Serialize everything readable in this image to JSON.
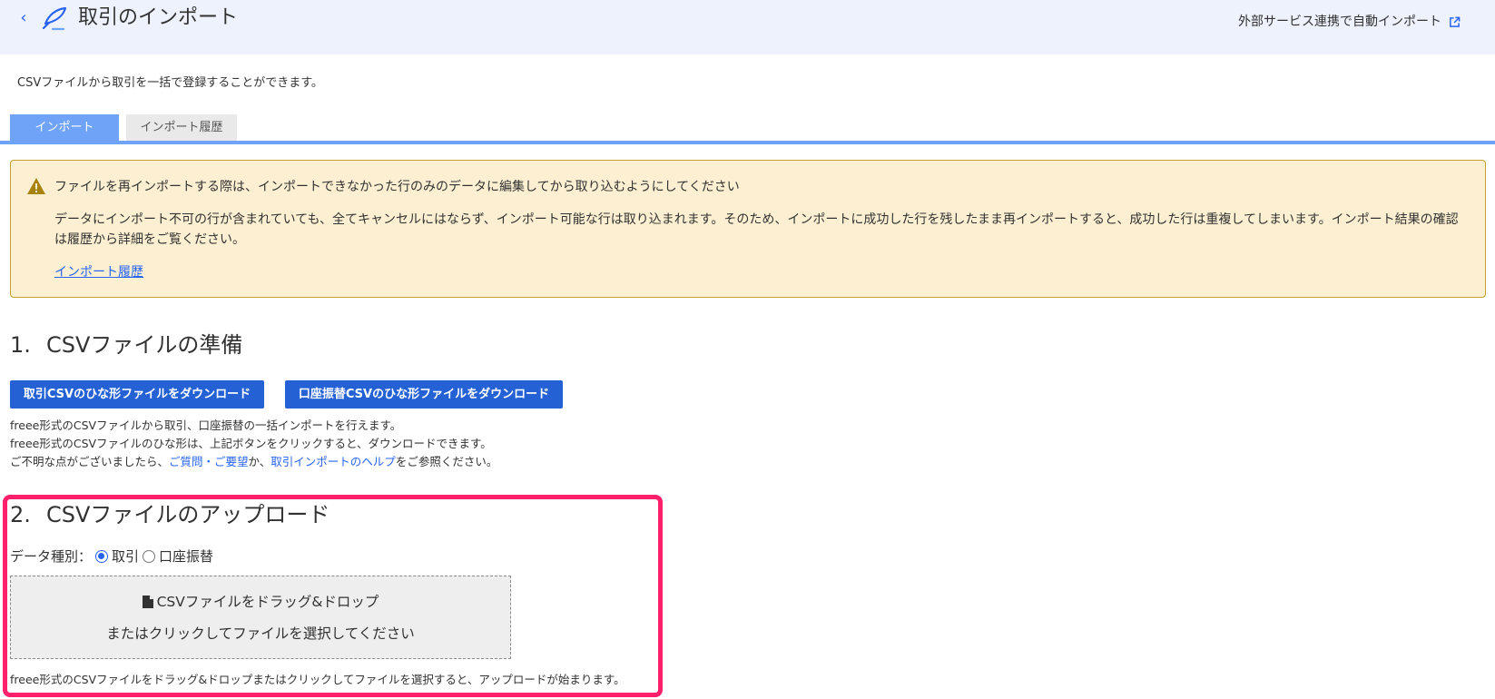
{
  "header": {
    "title": "取引のインポート",
    "external_link": "外部サービス連携で自動インポート"
  },
  "intro": "CSVファイルから取引を一括で登録することができます。",
  "tabs": [
    {
      "label": "インポート",
      "active": true
    },
    {
      "label": "インポート履歴",
      "active": false
    }
  ],
  "alert": {
    "title": "ファイルを再インポートする際は、インポートできなかった行のみのデータに編集してから取り込むようにしてください",
    "body": "データにインポート不可の行が含まれていても、全てキャンセルにはならず、インポート可能な行は取り込まれます。そのため、インポートに成功した行を残したまま再インポートすると、成功した行は重複してしまいます。インポート結果の確認は履歴から詳細をご覧ください。",
    "link": "インポート履歴"
  },
  "section1": {
    "number": "1.",
    "title": "CSVファイルの準備",
    "buttons": {
      "deal_template": "取引CSVのひな形ファイルをダウンロード",
      "transfer_template": "口座振替CSVのひな形ファイルをダウンロード"
    },
    "notes": {
      "line1": "freee形式のCSVファイルから取引、口座振替の一括インポートを行えます。",
      "line2": "freee形式のCSVファイルのひな形は、上記ボタンをクリックすると、ダウンロードできます。",
      "line3_prefix": "ご不明な点がございましたら、",
      "link_faq": "ご質問・ご要望",
      "line3_mid": "か、",
      "link_help": "取引インポートのヘルプ",
      "line3_suffix": "をご参照ください。"
    }
  },
  "section2": {
    "number": "2.",
    "title": "CSVファイルのアップロード",
    "data_type_label": "データ種別：",
    "options": [
      {
        "label": "取引",
        "selected": true
      },
      {
        "label": "口座振替",
        "selected": false
      }
    ],
    "dropzone": {
      "line1": "CSVファイルをドラッグ&ドロップ",
      "line2": "またはクリックしてファイルを選択してください"
    },
    "note": "freee形式のCSVファイルをドラッグ&ドロップまたはクリックしてファイルを選択すると、アップロードが始まります。"
  },
  "colors": {
    "accent": "#2864f0",
    "button": "#2461d4",
    "tab_active": "#6fa3f7",
    "alert_bg": "#fdf0d2",
    "alert_border": "#c6a12e",
    "highlight": "#ff1f6b"
  },
  "icons": {
    "back": "chevron-left-icon",
    "app": "import-quill-icon",
    "external": "external-link-icon",
    "warning": "warning-triangle-icon",
    "file": "file-icon"
  }
}
